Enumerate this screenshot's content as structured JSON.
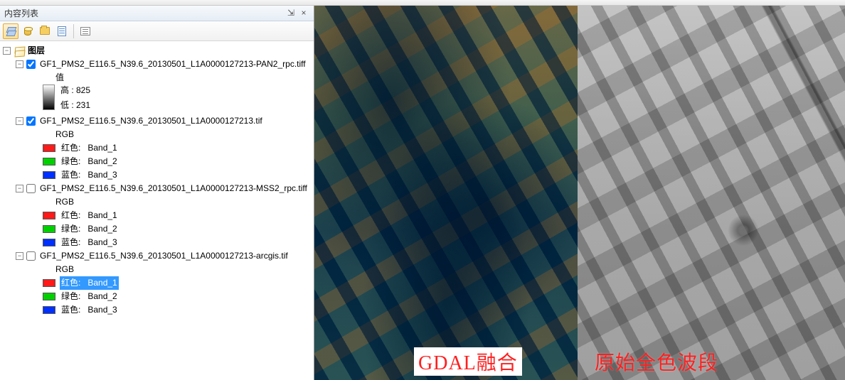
{
  "toc": {
    "title": "内容列表",
    "root_label": "图层",
    "layers": [
      {
        "name": "GF1_PMS2_E116.5_N39.6_20130501_L1A0000127213-PAN2_rpc.tiff",
        "checked": true,
        "render": {
          "type": "stretched",
          "header": "值",
          "high_label": "高 :",
          "high_value": "825",
          "low_label": "低 :",
          "low_value": "231"
        }
      },
      {
        "name": "GF1_PMS2_E116.5_N39.6_20130501_L1A0000127213.tif",
        "checked": true,
        "render": {
          "type": "rgb",
          "header": "RGB",
          "bands": [
            {
              "color": "#ff1a1a",
              "label": "红色:",
              "band": "Band_1",
              "selected": false
            },
            {
              "color": "#00d000",
              "label": "绿色:",
              "band": "Band_2",
              "selected": false
            },
            {
              "color": "#0030ff",
              "label": "蓝色:",
              "band": "Band_3",
              "selected": false
            }
          ]
        }
      },
      {
        "name": "GF1_PMS2_E116.5_N39.6_20130501_L1A0000127213-MSS2_rpc.tiff",
        "checked": false,
        "render": {
          "type": "rgb",
          "header": "RGB",
          "bands": [
            {
              "color": "#ff1a1a",
              "label": "红色:",
              "band": "Band_1",
              "selected": false
            },
            {
              "color": "#00d000",
              "label": "绿色:",
              "band": "Band_2",
              "selected": false
            },
            {
              "color": "#0030ff",
              "label": "蓝色:",
              "band": "Band_3",
              "selected": false
            }
          ]
        }
      },
      {
        "name": "GF1_PMS2_E116.5_N39.6_20130501_L1A0000127213-arcgis.tif",
        "checked": false,
        "render": {
          "type": "rgb",
          "header": "RGB",
          "bands": [
            {
              "color": "#ff1a1a",
              "label": "红色:",
              "band": "Band_1",
              "selected": true
            },
            {
              "color": "#00d000",
              "label": "绿色:",
              "band": "Band_2",
              "selected": false
            },
            {
              "color": "#0030ff",
              "label": "蓝色:",
              "band": "Band_3",
              "selected": false
            }
          ]
        }
      }
    ]
  },
  "map": {
    "left_annotation": "GDAL融合",
    "right_annotation": "原始全色波段"
  },
  "header_buttons": {
    "pin": "⇲",
    "close": "×"
  }
}
